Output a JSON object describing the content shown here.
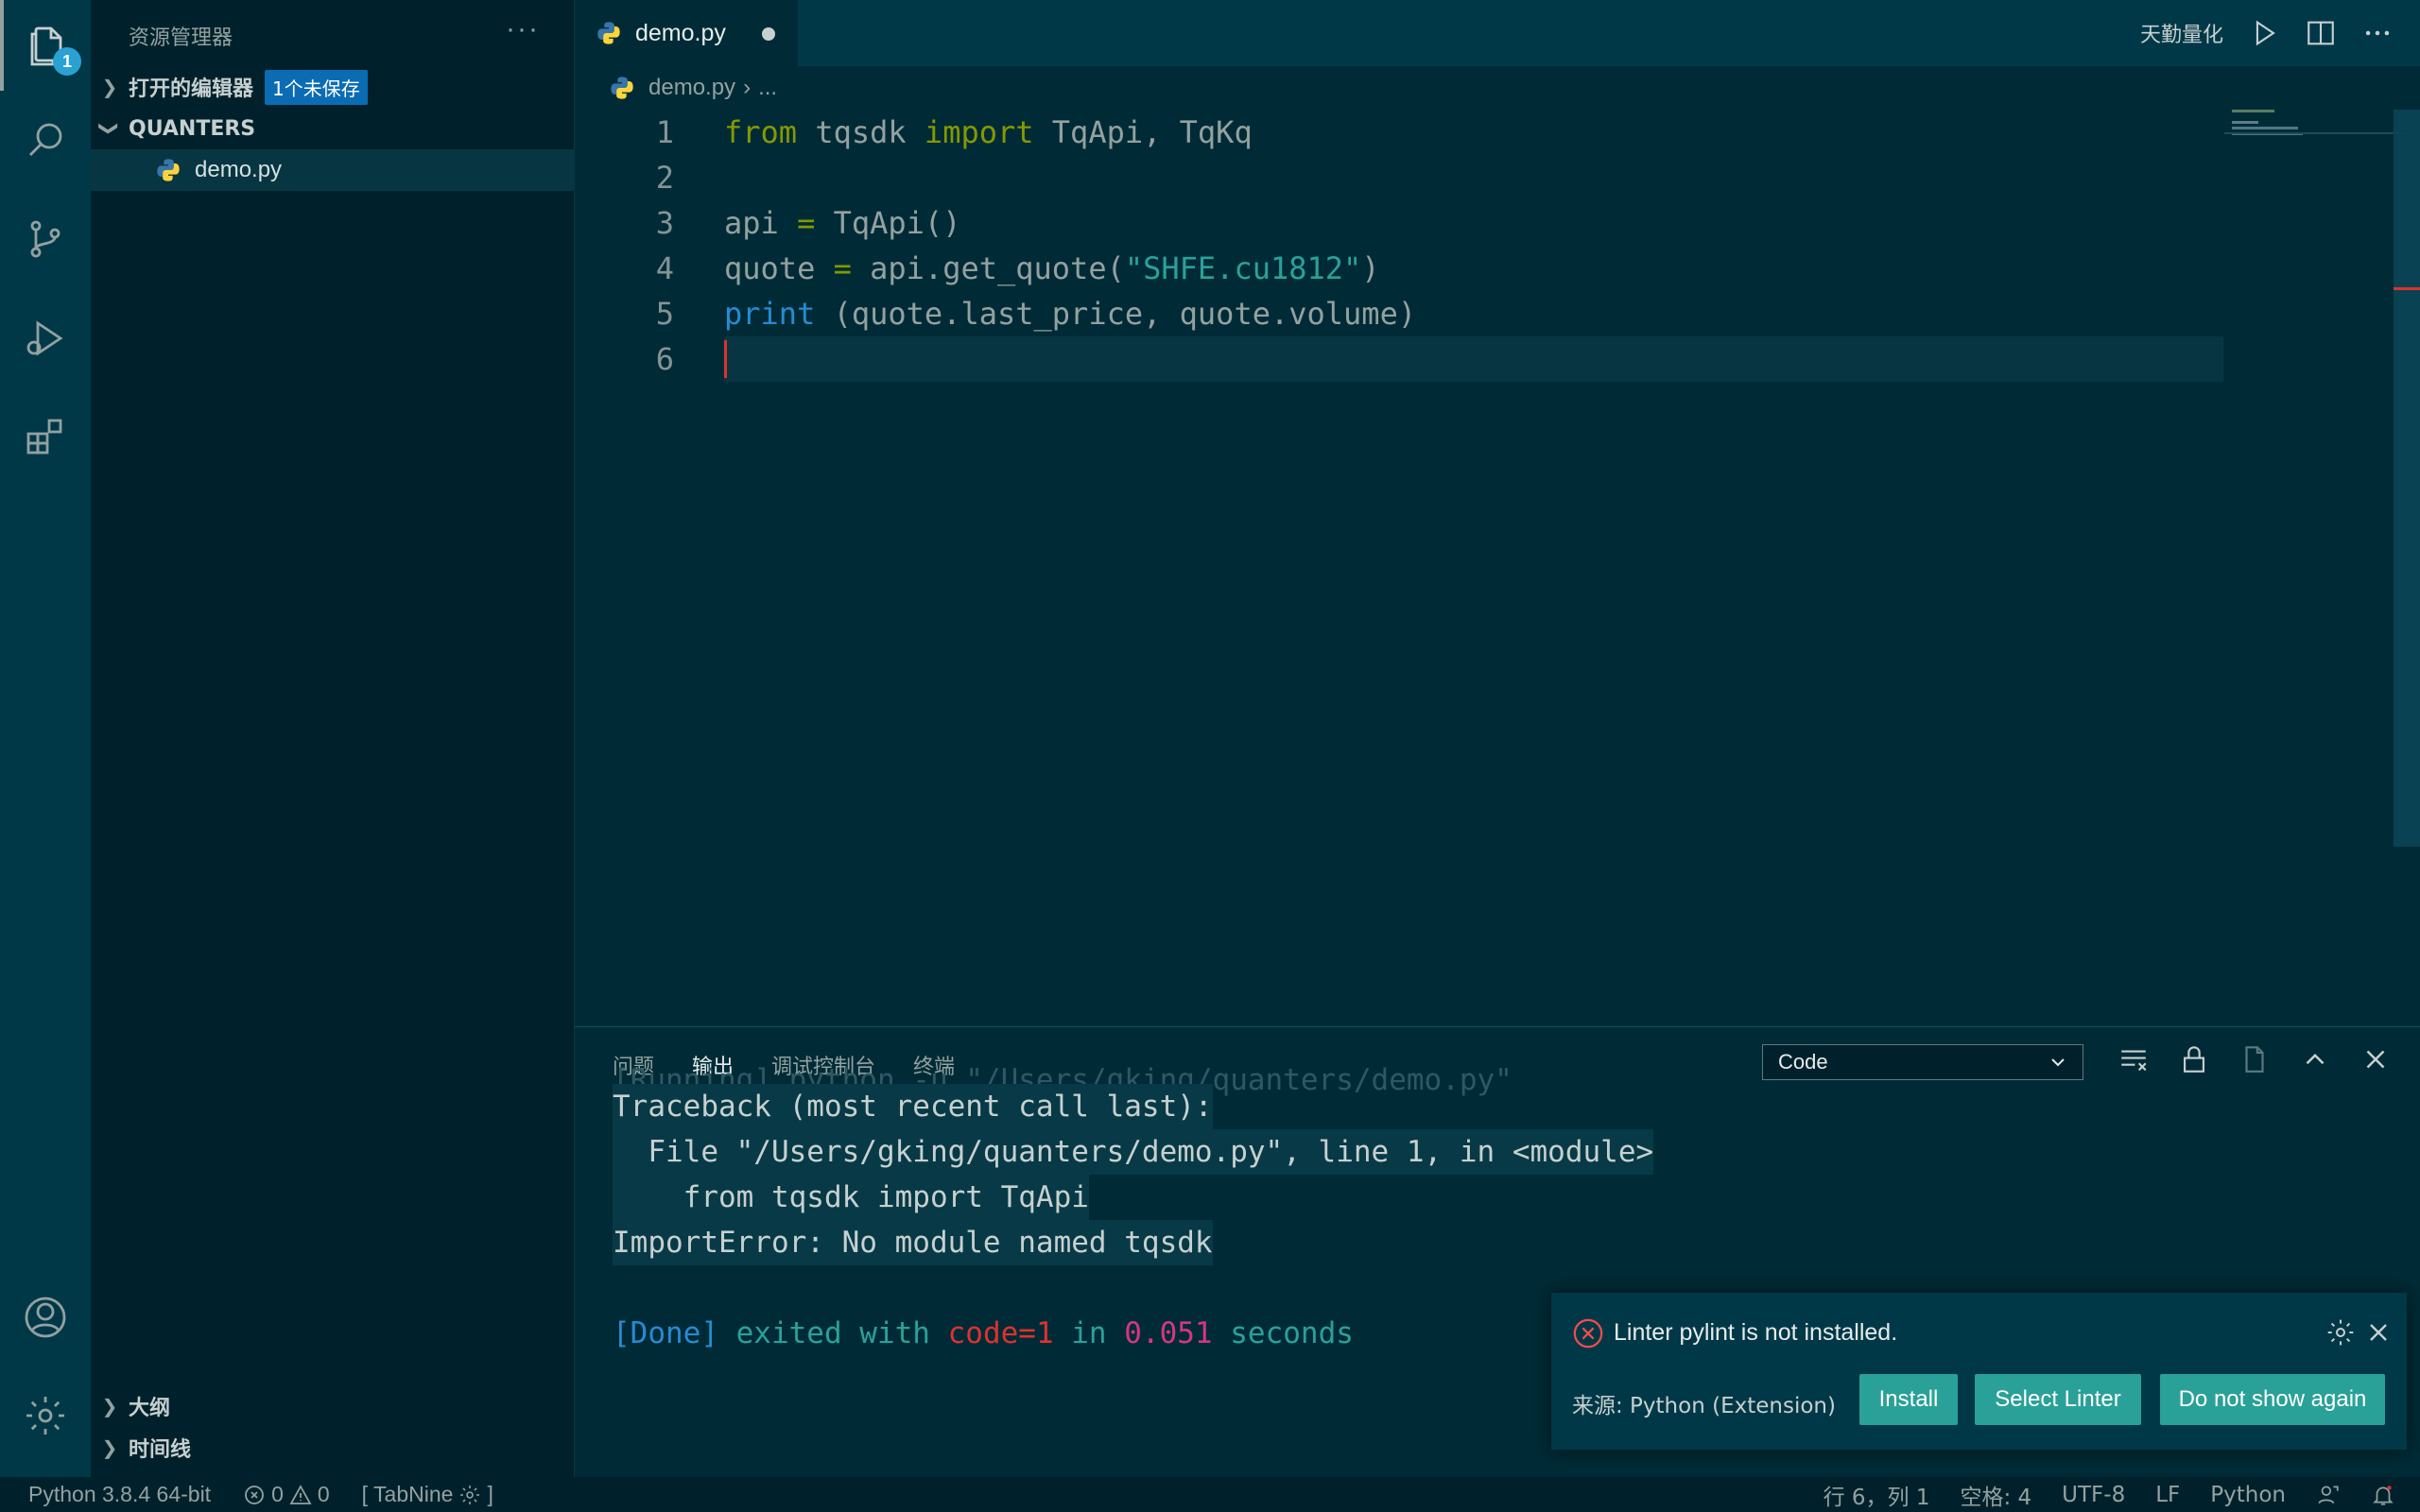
{
  "explorer": {
    "title": "资源管理器",
    "more": "···",
    "open_editors_label": "打开的编辑器",
    "unsaved_badge": "1个未保存",
    "folder_label": "QUANTERS",
    "file": "demo.py",
    "outline_label": "大纲",
    "timeline_label": "时间线"
  },
  "activity": {
    "explorer_badge": "1"
  },
  "tab": {
    "label": "demo.py"
  },
  "titlebar": {
    "extension_label": "天勤量化"
  },
  "breadcrumb": {
    "file": "demo.py",
    "more": "..."
  },
  "editor": {
    "line_numbers": [
      "1",
      "2",
      "3",
      "4",
      "5",
      "6"
    ]
  },
  "panel": {
    "tabs": [
      "问题",
      "输出",
      "调试控制台",
      "终端"
    ],
    "active_tab": "输出",
    "channel": "Code",
    "output": {
      "partial_line": "[Running] python -u \"/Users/gking/quanters/demo.py\"",
      "traceback": "Traceback (most recent call last):",
      "file_line": "  File \"/Users/gking/quanters/demo.py\", line 1, in <module>",
      "from_line": "    from tqsdk import TqApi",
      "import_error": "ImportError: No module named tqsdk",
      "done_tag": "[Done]",
      "exited_with": " exited with ",
      "code": "code=1",
      "in": " in ",
      "seconds_value": "0.051",
      "seconds": " seconds"
    }
  },
  "notification": {
    "message": "Linter pylint is not installed.",
    "source": "来源: Python (Extension)",
    "install": "Install",
    "select_linter": "Select Linter",
    "dont_show": "Do not show again"
  },
  "status": {
    "interpreter": "Python 3.8.4 64-bit",
    "errors": "0",
    "warnings": "0",
    "tabnine_open": "[ TabNine",
    "tabnine_close": "]",
    "position": "行 6，列 1",
    "spaces": "空格: 4",
    "encoding": "UTF-8",
    "eol": "LF",
    "language": "Python"
  },
  "colors": {
    "background": "#002b36",
    "keyword": "#859900",
    "function": "#268bd2",
    "string": "#2aa198",
    "error": "#dc322f",
    "button": "#2aa198"
  }
}
